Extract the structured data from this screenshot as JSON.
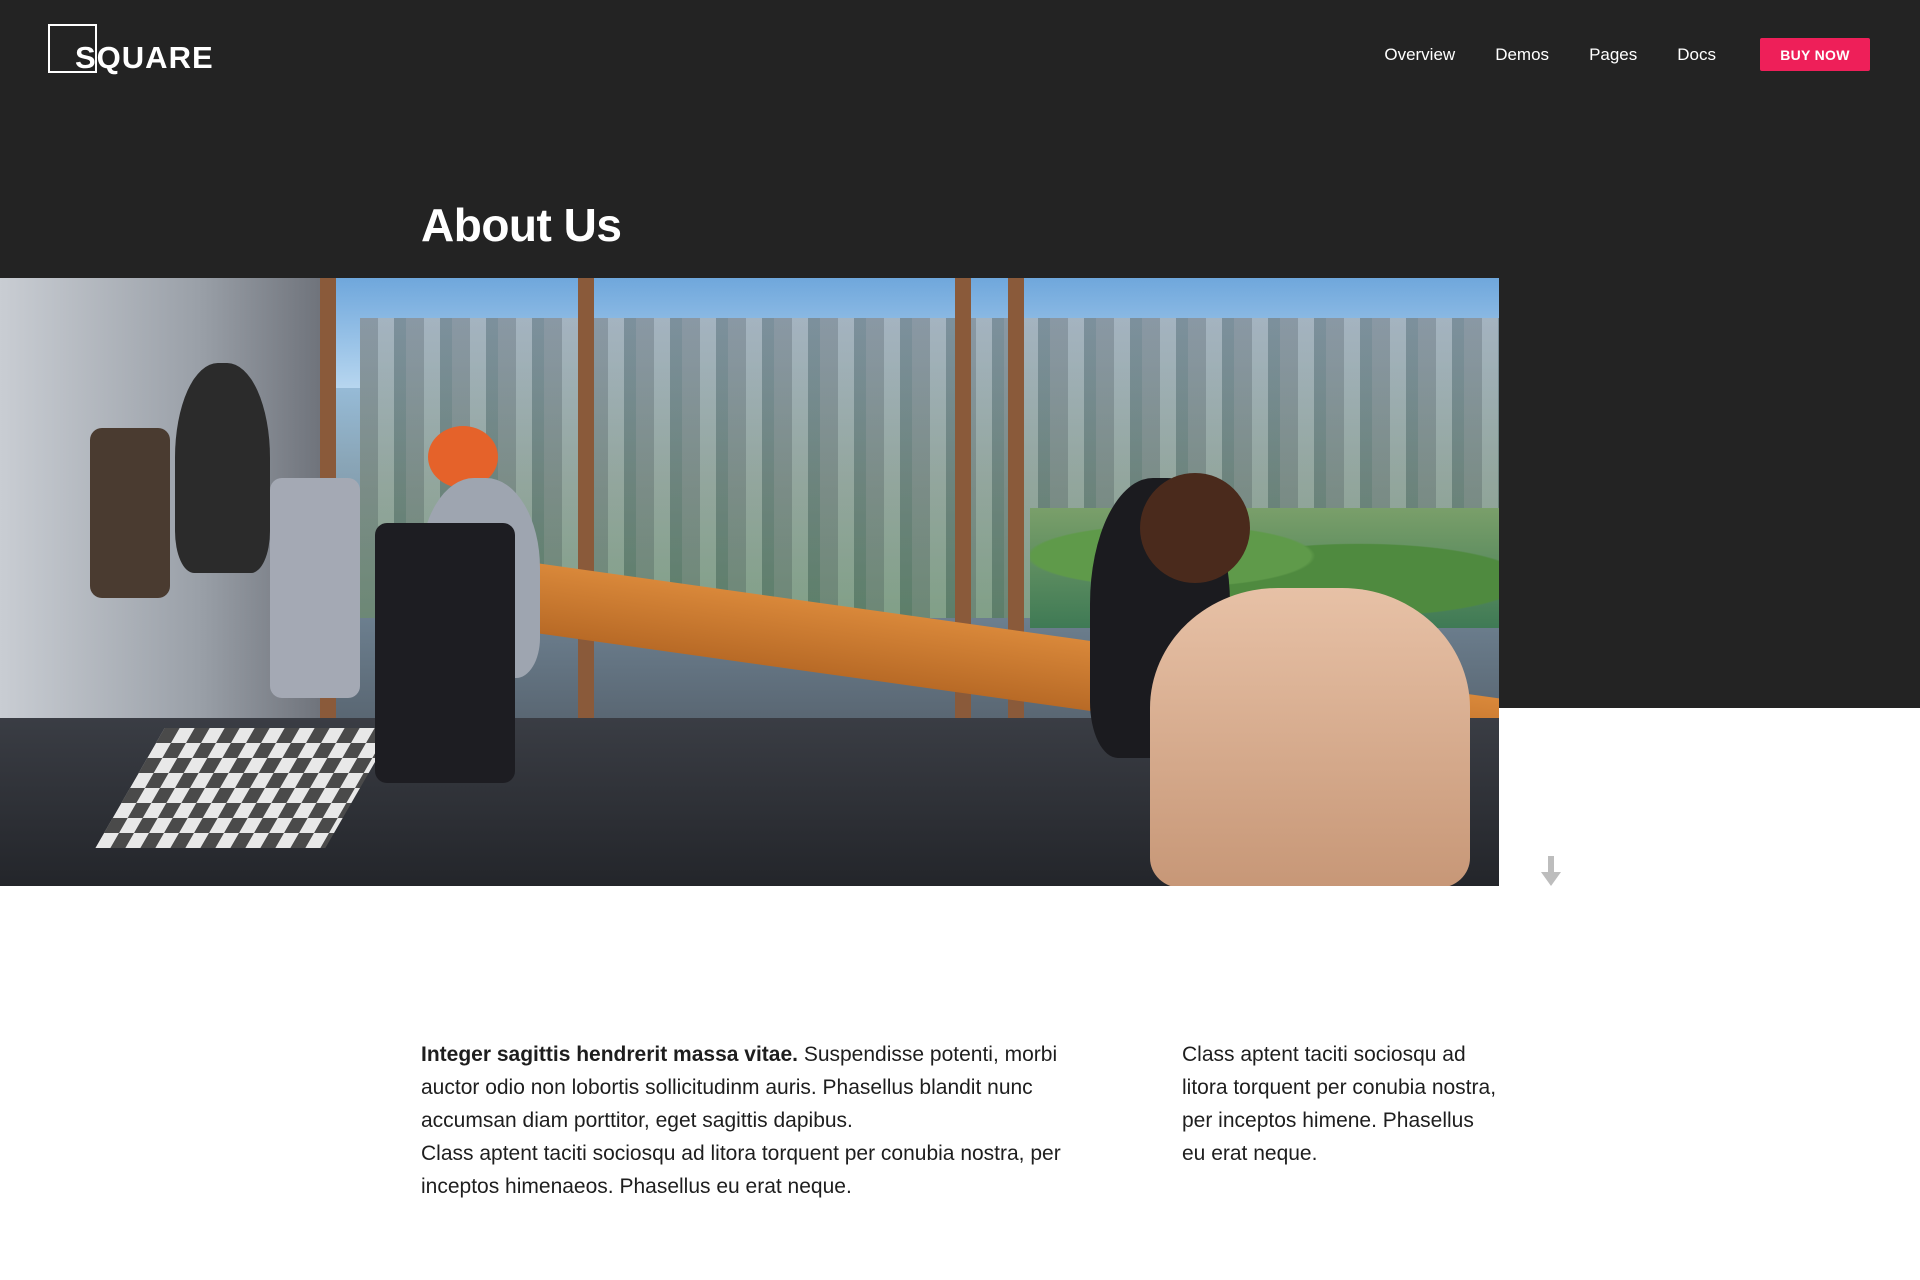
{
  "header": {
    "logo_text": "SQUARE",
    "nav": [
      "Overview",
      "Demos",
      "Pages",
      "Docs"
    ],
    "cta_label": "BUY NOW"
  },
  "hero": {
    "title": "About Us",
    "image_alt": "Office team working at desks by panoramic city windows"
  },
  "content": {
    "left_lead": "Integer sagittis hendrerit massa vitae.",
    "left_text_1": " Suspendisse potenti, morbi auctor odio non lobortis sollicitudinm auris. Phasellus blandit nunc accumsan diam porttitor, eget sagittis dapibus.",
    "left_text_2": "Class aptent taciti sociosqu ad litora torquent per conubia nostra, per inceptos himenaeos. Phasellus eu erat neque.",
    "right_text": "Class aptent taciti sociosqu ad litora torquent per conubia nostra, per inceptos himene. Phasellus eu erat neque."
  },
  "icons": {
    "scroll_down": "arrow-down-icon"
  },
  "colors": {
    "dark_bg": "#232323",
    "accent": "#ee1f59",
    "text": "#1e1e1e"
  }
}
